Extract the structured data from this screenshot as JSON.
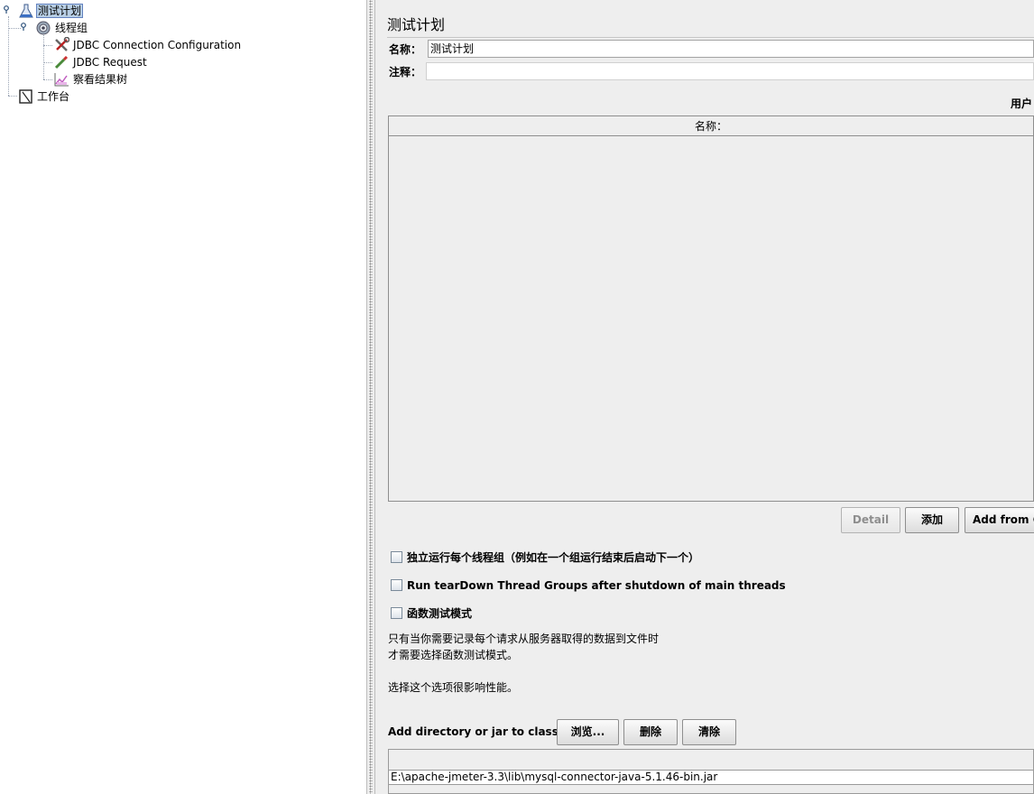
{
  "tree": {
    "nodes": [
      {
        "label": "测试计划",
        "icon": "test-plan-icon"
      },
      {
        "label": "线程组",
        "icon": "thread-group-icon"
      },
      {
        "label": "JDBC Connection Configuration",
        "icon": "config-tools-icon"
      },
      {
        "label": "JDBC Request",
        "icon": "sampler-pipette-icon"
      },
      {
        "label": "察看结果树",
        "icon": "listener-chart-icon"
      },
      {
        "label": "工作台",
        "icon": "workbench-icon"
      }
    ]
  },
  "panel": {
    "title": "测试计划",
    "name_label": "名称：",
    "name_value": "测试计划",
    "comment_label": "注释：",
    "comment_value": "",
    "user_vars_label": "用户",
    "table_header_name": "名称：",
    "buttons": {
      "detail": "Detail",
      "add": "添加",
      "add_from_clipboard": "Add from C"
    },
    "checkboxes": {
      "serialize": "独立运行每个线程组（例如在一个组运行结束后启动下一个）",
      "teardown": "Run tearDown Thread Groups after shutdown of main threads",
      "functional": "函数测试模式"
    },
    "functional_note": {
      "line1": "只有当你需要记录每个请求从服务器取得的数据到文件时",
      "line2": "才需要选择函数测试模式。",
      "line3": "选择这个选项很影响性能。"
    },
    "classpath": {
      "label": "Add directory or jar to classpath",
      "browse": "浏览...",
      "delete": "删除",
      "clear": "清除",
      "entry": "E:\\apache-jmeter-3.3\\lib\\mysql-connector-java-5.1.46-bin.jar"
    }
  },
  "colors": {
    "selection": "#b8cfe5",
    "panel_bg": "#eeeeee"
  }
}
